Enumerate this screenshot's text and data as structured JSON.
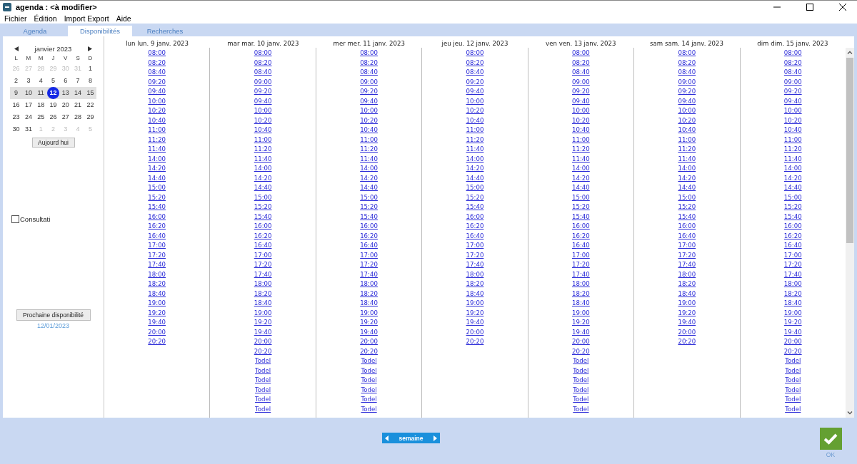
{
  "window": {
    "title": "agenda : <à modifier>"
  },
  "menu": [
    "Fichier",
    "Édition",
    "Import Export",
    "Aide"
  ],
  "tabs": [
    {
      "label": "Agenda",
      "selected": false
    },
    {
      "label": "Disponibilités",
      "selected": true
    },
    {
      "label": "Recherches",
      "selected": false
    }
  ],
  "calendar": {
    "month_label": "janvier 2023",
    "weekdays": [
      "L",
      "M",
      "M",
      "J",
      "V",
      "S",
      "D"
    ],
    "weeks": [
      {
        "highlighted": false,
        "days": [
          {
            "label": "26",
            "muted": true,
            "selected": false
          },
          {
            "label": "27",
            "muted": true,
            "selected": false
          },
          {
            "label": "28",
            "muted": true,
            "selected": false
          },
          {
            "label": "29",
            "muted": true,
            "selected": false
          },
          {
            "label": "30",
            "muted": true,
            "selected": false
          },
          {
            "label": "31",
            "muted": true,
            "selected": false
          },
          {
            "label": "1",
            "muted": false,
            "selected": false
          }
        ]
      },
      {
        "highlighted": false,
        "days": [
          {
            "label": "2",
            "muted": false,
            "selected": false
          },
          {
            "label": "3",
            "muted": false,
            "selected": false
          },
          {
            "label": "4",
            "muted": false,
            "selected": false
          },
          {
            "label": "5",
            "muted": false,
            "selected": false
          },
          {
            "label": "6",
            "muted": false,
            "selected": false
          },
          {
            "label": "7",
            "muted": false,
            "selected": false
          },
          {
            "label": "8",
            "muted": false,
            "selected": false
          }
        ]
      },
      {
        "highlighted": true,
        "days": [
          {
            "label": "9",
            "muted": false,
            "selected": false
          },
          {
            "label": "10",
            "muted": false,
            "selected": false
          },
          {
            "label": "11",
            "muted": false,
            "selected": false
          },
          {
            "label": "12",
            "muted": false,
            "selected": true
          },
          {
            "label": "13",
            "muted": false,
            "selected": false
          },
          {
            "label": "14",
            "muted": false,
            "selected": false
          },
          {
            "label": "15",
            "muted": false,
            "selected": false
          }
        ]
      },
      {
        "highlighted": false,
        "days": [
          {
            "label": "16",
            "muted": false,
            "selected": false
          },
          {
            "label": "17",
            "muted": false,
            "selected": false
          },
          {
            "label": "18",
            "muted": false,
            "selected": false
          },
          {
            "label": "19",
            "muted": false,
            "selected": false
          },
          {
            "label": "20",
            "muted": false,
            "selected": false
          },
          {
            "label": "21",
            "muted": false,
            "selected": false
          },
          {
            "label": "22",
            "muted": false,
            "selected": false
          }
        ]
      },
      {
        "highlighted": false,
        "days": [
          {
            "label": "23",
            "muted": false,
            "selected": false
          },
          {
            "label": "24",
            "muted": false,
            "selected": false
          },
          {
            "label": "25",
            "muted": false,
            "selected": false
          },
          {
            "label": "26",
            "muted": false,
            "selected": false
          },
          {
            "label": "27",
            "muted": false,
            "selected": false
          },
          {
            "label": "28",
            "muted": false,
            "selected": false
          },
          {
            "label": "29",
            "muted": false,
            "selected": false
          }
        ]
      },
      {
        "highlighted": false,
        "days": [
          {
            "label": "30",
            "muted": false,
            "selected": false
          },
          {
            "label": "31",
            "muted": false,
            "selected": false
          },
          {
            "label": "1",
            "muted": true,
            "selected": false
          },
          {
            "label": "2",
            "muted": true,
            "selected": false
          },
          {
            "label": "3",
            "muted": true,
            "selected": false
          },
          {
            "label": "4",
            "muted": true,
            "selected": false
          },
          {
            "label": "5",
            "muted": true,
            "selected": false
          }
        ]
      }
    ],
    "today_button": "Aujourd hui"
  },
  "consultation": {
    "label": "Consultati",
    "checked": false
  },
  "next_availability": {
    "button": "Prochaine disponibilité",
    "date": "12/01/2023"
  },
  "days": [
    {
      "header": "lun lun. 9 janv. 2023",
      "slots": [
        "08:00",
        "08:20",
        "08:40",
        "09:20",
        "09:40",
        "10:00",
        "10:20",
        "10:40",
        "11:00",
        "11:20",
        "11:40",
        "14:00",
        "14:20",
        "14:40",
        "15:00",
        "15:20",
        "15:40",
        "16:00",
        "16:20",
        "16:40",
        "17:00",
        "17:20",
        "17:40",
        "18:00",
        "18:20",
        "18:40",
        "19:00",
        "19:20",
        "19:40",
        "20:00",
        "20:20"
      ]
    },
    {
      "header": "mar mar. 10 janv. 2023",
      "slots": [
        "08:00",
        "08:20",
        "08:40",
        "09:00",
        "09:20",
        "09:40",
        "10:00",
        "10:20",
        "10:40",
        "11:00",
        "11:20",
        "11:40",
        "14:00",
        "14:20",
        "14:40",
        "15:00",
        "15:20",
        "15:40",
        "16:00",
        "16:20",
        "16:40",
        "17:00",
        "17:20",
        "17:40",
        "18:00",
        "18:20",
        "18:40",
        "19:00",
        "19:20",
        "19:40",
        "20:00",
        "20:20",
        "Todel",
        "Todel",
        "Todel",
        "Todel",
        "Todel",
        "Todel"
      ]
    },
    {
      "header": "mer mer. 11 janv. 2023",
      "slots": [
        "08:00",
        "08:20",
        "08:40",
        "09:00",
        "09:20",
        "09:40",
        "10:00",
        "10:20",
        "10:40",
        "11:00",
        "11:20",
        "11:40",
        "14:00",
        "14:20",
        "14:40",
        "15:00",
        "15:20",
        "15:40",
        "16:00",
        "16:20",
        "16:40",
        "17:00",
        "17:20",
        "17:40",
        "18:00",
        "18:20",
        "18:40",
        "19:00",
        "19:20",
        "19:40",
        "20:00",
        "20:20",
        "Todel",
        "Todel",
        "Todel",
        "Todel",
        "Todel",
        "Todel"
      ]
    },
    {
      "header": "jeu jeu. 12 janv. 2023",
      "slots": [
        "08:00",
        "08:20",
        "08:40",
        "09:20",
        "09:40",
        "10:00",
        "10:20",
        "10:40",
        "11:00",
        "11:20",
        "11:40",
        "14:00",
        "14:20",
        "14:40",
        "15:00",
        "15:20",
        "15:40",
        "16:00",
        "16:20",
        "16:40",
        "17:00",
        "17:20",
        "17:40",
        "18:00",
        "18:20",
        "18:40",
        "19:00",
        "19:20",
        "19:40",
        "20:00",
        "20:20"
      ]
    },
    {
      "header": "ven ven. 13 janv. 2023",
      "slots": [
        "08:00",
        "08:20",
        "08:40",
        "09:00",
        "09:20",
        "09:40",
        "10:00",
        "10:20",
        "10:40",
        "11:00",
        "11:20",
        "11:40",
        "14:00",
        "14:20",
        "14:40",
        "15:00",
        "15:20",
        "15:40",
        "16:00",
        "16:20",
        "16:40",
        "17:00",
        "17:20",
        "17:40",
        "18:00",
        "18:20",
        "18:40",
        "19:00",
        "19:20",
        "19:40",
        "20:00",
        "20:20",
        "Todel",
        "Todel",
        "Todel",
        "Todel",
        "Todel",
        "Todel"
      ]
    },
    {
      "header": "sam sam. 14 janv. 2023",
      "slots": [
        "08:00",
        "08:20",
        "08:40",
        "09:00",
        "09:20",
        "09:40",
        "10:00",
        "10:20",
        "10:40",
        "11:00",
        "11:20",
        "11:40",
        "14:00",
        "14:20",
        "14:40",
        "15:00",
        "15:20",
        "15:40",
        "16:00",
        "16:40",
        "17:00",
        "17:20",
        "17:40",
        "18:00",
        "18:20",
        "18:40",
        "19:00",
        "19:20",
        "19:40",
        "20:00",
        "20:20"
      ]
    },
    {
      "header": "dim dim. 15 janv. 2023",
      "slots": [
        "08:00",
        "08:20",
        "08:40",
        "09:00",
        "09:20",
        "09:40",
        "10:00",
        "10:20",
        "10:40",
        "11:00",
        "11:20",
        "11:40",
        "14:00",
        "14:20",
        "14:40",
        "15:00",
        "15:20",
        "15:40",
        "16:00",
        "16:20",
        "16:40",
        "17:00",
        "17:20",
        "17:40",
        "18:00",
        "18:20",
        "18:40",
        "19:00",
        "19:20",
        "19:40",
        "20:00",
        "20:20",
        "Todel",
        "Todel",
        "Todel",
        "Todel",
        "Todel",
        "Todel"
      ]
    }
  ],
  "week_nav": {
    "label": "semaine"
  },
  "ok_button": {
    "label": "OK"
  }
}
